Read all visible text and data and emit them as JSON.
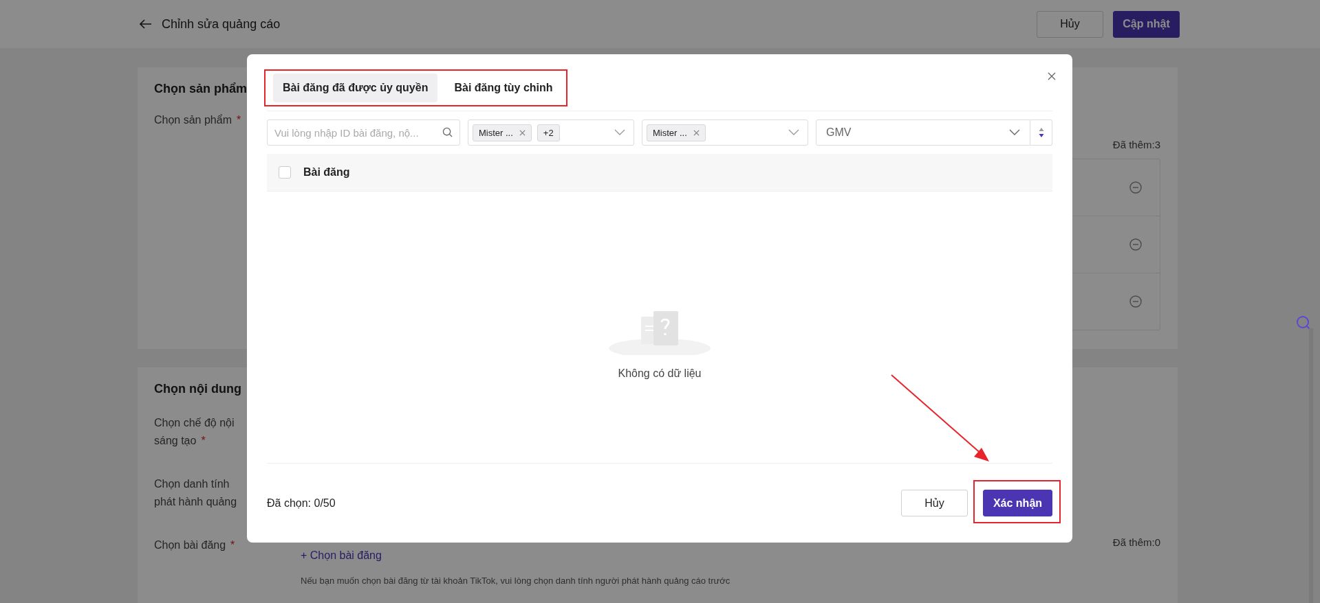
{
  "header": {
    "title": "Chỉnh sửa quảng cáo",
    "buttons": [
      {
        "label": "Hủy",
        "kind": "secondary"
      },
      {
        "label": "Cập nhật",
        "kind": "primary"
      }
    ]
  },
  "sections": [
    {
      "title": "Chọn sản phẩm",
      "fields": [
        {
          "label_lines": [
            "Chọn sản phẩm"
          ],
          "required_mark": "*",
          "added": "Đã thêm:3",
          "items": [
            {
              "removable": true
            },
            {
              "removable": true
            },
            {
              "removable": true
            }
          ]
        }
      ]
    },
    {
      "title": "Chọn nội dung",
      "fields": [
        {
          "label_lines": [
            "Chọn chế độ nội",
            "sáng tạo"
          ],
          "required_mark": "*"
        },
        {
          "label_lines": [
            "Chọn danh tính",
            "phát hành quảng"
          ]
        },
        {
          "label_lines": [
            "Chọn bài đăng"
          ],
          "required_mark": "*",
          "added": "Đã thêm:0",
          "link": "+ Chọn bài đăng",
          "hint": "Nếu bạn muốn chọn bài đăng từ tài khoản TikTok, vui lòng chọn danh tính người phát hành quảng cáo trước"
        }
      ]
    }
  ],
  "dialog": {
    "tabs_highlighted": true,
    "tabs": [
      {
        "label": "Bài đăng đã được ủy quyền",
        "selected": true
      },
      {
        "label": "Bài đăng tùy chỉnh",
        "selected": false
      }
    ],
    "search": {
      "placeholder": "Vui lòng nhập ID bài đăng, nộ..."
    },
    "filters": [
      {
        "kind": "multi",
        "tags": [
          {
            "text": "Mister ...",
            "removable": true
          },
          {
            "text": "+2",
            "removable": false
          }
        ]
      },
      {
        "kind": "multi",
        "tags": [
          {
            "text": "Mister ...",
            "removable": true
          }
        ]
      },
      {
        "kind": "single",
        "value": "GMV"
      }
    ],
    "table": {
      "select_all_checked": false,
      "columns": [
        "Bài đăng"
      ],
      "empty_text": "Không có dữ liệu"
    },
    "footer": {
      "selected_count": "Đã chọn: 0/50",
      "buttons": [
        {
          "label": "Hủy",
          "kind": "secondary",
          "highlighted": false
        },
        {
          "label": "Xác nhận",
          "kind": "primary",
          "highlighted": true
        }
      ]
    }
  },
  "annotations": [
    {
      "kind": "arrow"
    }
  ]
}
